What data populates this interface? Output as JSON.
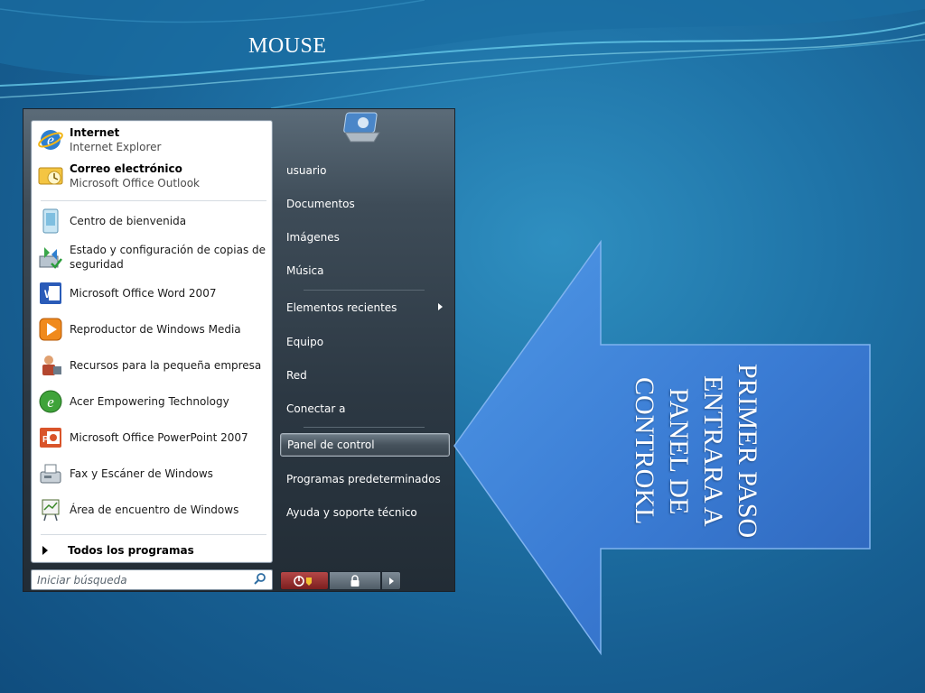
{
  "slide": {
    "title": "MOUSE",
    "arrow_text": "PRIMER PASO ENTRARA A PANEL DE CONTROKL"
  },
  "start_menu": {
    "programs": [
      {
        "title": "Internet",
        "subtitle": "Internet Explorer",
        "icon": "internet-explorer-icon"
      },
      {
        "title": "Correo electrónico",
        "subtitle": "Microsoft Office Outlook",
        "icon": "outlook-icon"
      },
      {
        "label": "Centro de bienvenida",
        "icon": "welcome-center-icon"
      },
      {
        "label": "Estado y configuración de copias de seguridad",
        "icon": "backup-icon"
      },
      {
        "label": "Microsoft Office Word 2007",
        "icon": "word-icon"
      },
      {
        "label": "Reproductor de Windows Media",
        "icon": "media-player-icon"
      },
      {
        "label": "Recursos para la pequeña empresa",
        "icon": "small-business-icon"
      },
      {
        "label": "Acer Empowering Technology",
        "icon": "acer-icon"
      },
      {
        "label": "Microsoft Office PowerPoint 2007",
        "icon": "powerpoint-icon"
      },
      {
        "label": "Fax y Escáner de Windows",
        "icon": "fax-icon"
      },
      {
        "label": "Área de encuentro de Windows",
        "icon": "meeting-space-icon"
      }
    ],
    "all_programs": "Todos los programas",
    "search_placeholder": "Iniciar búsqueda",
    "right_items": [
      "usuario",
      "Documentos",
      "Imágenes",
      "Música",
      "Elementos recientes",
      "Equipo",
      "Red",
      "Conectar a",
      "Panel de control",
      "Programas predeterminados",
      "Ayuda y soporte técnico"
    ],
    "highlighted_item": "Panel de control"
  },
  "colors": {
    "background": "#1f74a8",
    "arrow_fill": "#3d7fd6",
    "menu_dark": "#2c3843",
    "power_button": "#9a2f2f"
  }
}
